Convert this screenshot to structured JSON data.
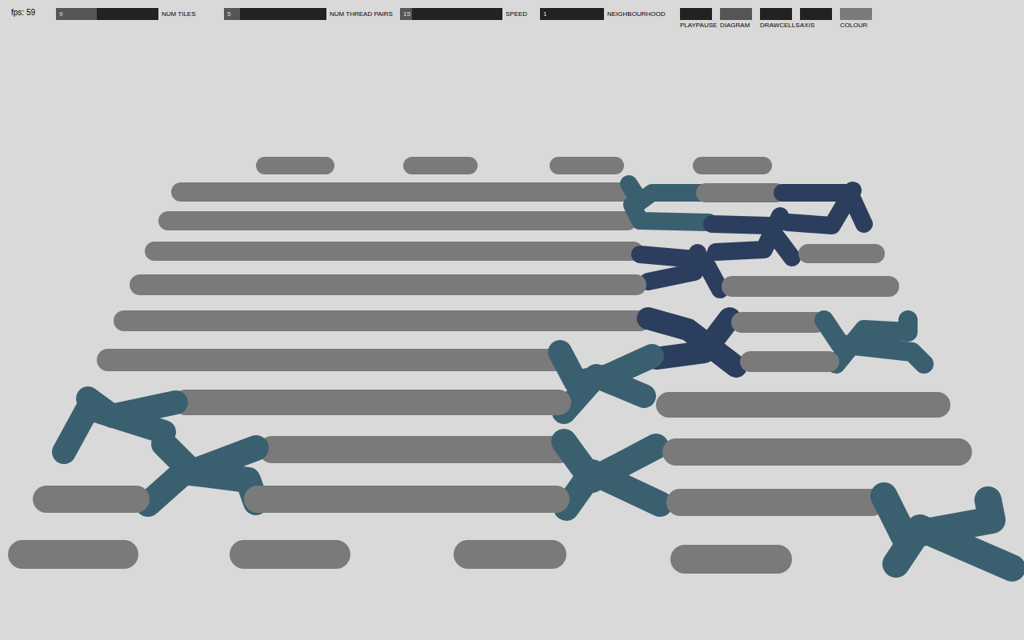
{
  "fps": "fps: 59",
  "sliders": [
    {
      "label": "NUM TILES",
      "value": "9",
      "level": 0.4
    },
    {
      "label": "NUM THREAD PAIRS",
      "value": "5",
      "level": 0.16
    },
    {
      "label": "SPEED",
      "value": "15",
      "level": 0.12
    },
    {
      "label": "NEIGHBOURHOOD",
      "value": "1",
      "level": 0
    }
  ],
  "buttons": [
    {
      "label": "PLAYPAUSE",
      "on": false,
      "color": "#222222"
    },
    {
      "label": "DIAGRAM",
      "on": true,
      "color": "#555555"
    },
    {
      "label": "DRAWCELLS",
      "on": false,
      "color": "#222222"
    },
    {
      "label": "AXIS",
      "on": false,
      "color": "#222222"
    },
    {
      "label": "COLOUR",
      "on": true,
      "color": "#7a7a7a"
    }
  ],
  "diagram": {
    "segments": [
      {
        "color": "#7a7a7a"
      },
      {
        "color": "#7a7a7a"
      },
      {
        "color": "#7a7a7a"
      },
      {
        "color": "#7a7a7a"
      },
      {
        "color": "#7a7a7a"
      },
      {
        "color": "#3a6070"
      },
      {
        "color": "#7a7a7a"
      },
      {
        "color": "#2c3e5e"
      },
      {
        "color": "#2c3e5e"
      },
      {
        "color": "#7a7a7a"
      },
      {
        "color": "#3a6070"
      },
      {
        "color": "#2c3e5e"
      },
      {
        "color": "#2c3e5e"
      },
      {
        "color": "#7a7a7a"
      },
      {
        "color": "#2c3e5e"
      },
      {
        "color": "#2c3e5e"
      },
      {
        "color": "#7a7a7a"
      },
      {
        "color": "#7a7a7a"
      },
      {
        "color": "#7a7a7a"
      },
      {
        "color": "#7a7a7a"
      },
      {
        "color": "#2c3e5e"
      },
      {
        "color": "#2c3e5e"
      },
      {
        "color": "#7a7a7a"
      },
      {
        "color": "#3a6070"
      },
      {
        "color": "#3a6070"
      },
      {
        "color": "#7a7a7a"
      },
      {
        "color": "#3a6070"
      },
      {
        "color": "#3a6070"
      },
      {
        "color": "#7a7a7a"
      },
      {
        "color": "#7a7a7a"
      },
      {
        "color": "#3a6070"
      },
      {
        "color": "#3a6070"
      },
      {
        "color": "#7a7a7a"
      },
      {
        "color": "#7a7a7a"
      },
      {
        "color": "#3a6070"
      },
      {
        "color": "#3a6070"
      },
      {
        "color": "#3a6070"
      },
      {
        "color": "#3a6070"
      },
      {
        "color": "#7a7a7a"
      },
      {
        "color": "#7a7a7a"
      },
      {
        "color": "#7a7a7a"
      },
      {
        "color": "#7a7a7a"
      },
      {
        "color": "#3a6070"
      },
      {
        "color": "#3a6070"
      },
      {
        "color": "#7a7a7a"
      },
      {
        "color": "#7a7a7a"
      },
      {
        "color": "#7a7a7a"
      },
      {
        "color": "#7a7a7a"
      }
    ]
  }
}
